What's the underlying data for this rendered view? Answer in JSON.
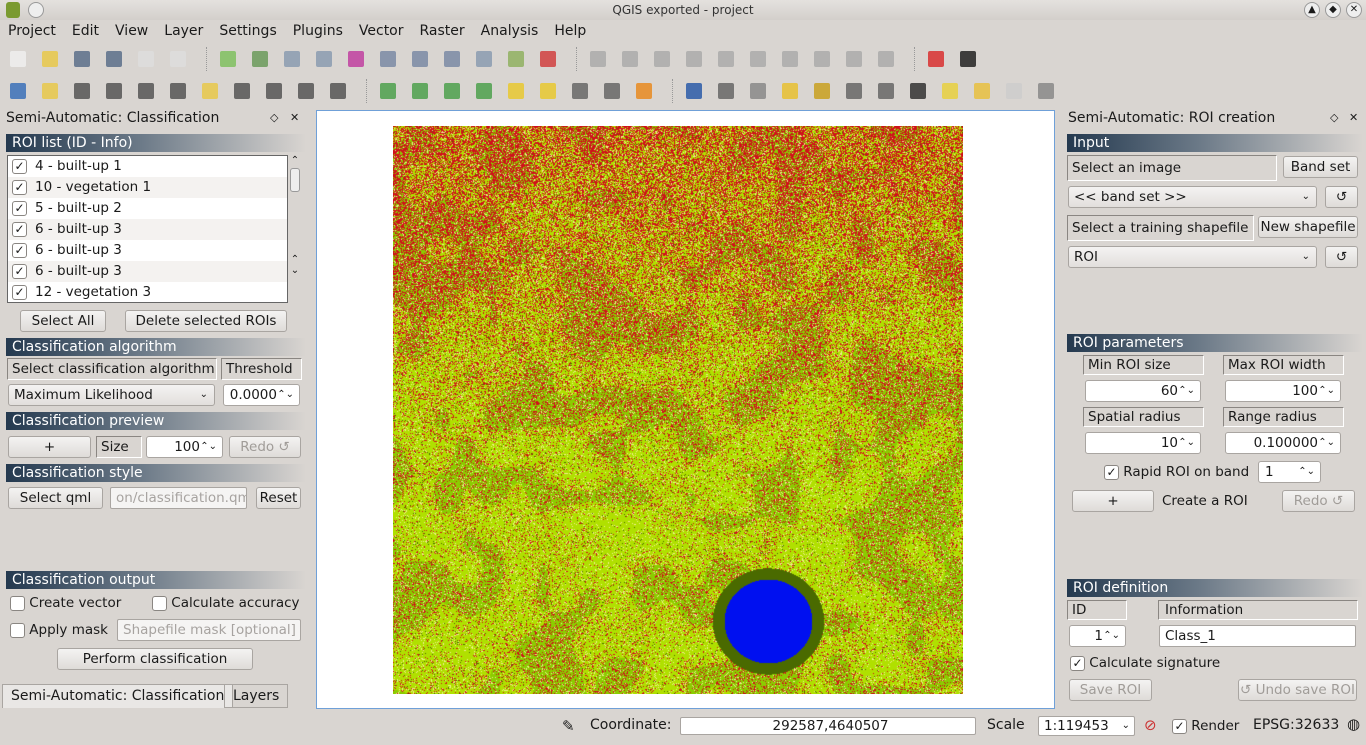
{
  "window": {
    "title": "QGIS exported - project",
    "controls": [
      "▲",
      "◆",
      "✕"
    ]
  },
  "menu": [
    "Project",
    "Edit",
    "View",
    "Layer",
    "Settings",
    "Plugins",
    "Vector",
    "Raster",
    "Analysis",
    "Help"
  ],
  "toolbar_icons": {
    "row1": [
      [
        "new-project-icon",
        "#eee"
      ],
      [
        "open-project-icon",
        "#e8c84a"
      ],
      [
        "save-project-icon",
        "#5a6f8a"
      ],
      [
        "save-as-icon",
        "#5a6f8a"
      ],
      [
        "new-print-composer-icon",
        "#ddd"
      ],
      [
        "composer-manager-icon",
        "#ddd"
      ],
      [
        "add-vector-layer-icon",
        "#7fbf5f"
      ],
      [
        "add-raster-layer-icon",
        "#6a9a5a"
      ],
      [
        "add-postgis-layer-icon",
        "#8a9bb0"
      ],
      [
        "add-spatialite-layer-icon",
        "#8a9bb0"
      ],
      [
        "add-mssql-layer-icon",
        "#c03fa0"
      ],
      [
        "add-wms-layer-icon",
        "#7a8aa5"
      ],
      [
        "add-wcs-layer-icon",
        "#7a8aa5"
      ],
      [
        "add-wfs-layer-icon",
        "#7a8aa5"
      ],
      [
        "add-delimited-text-icon",
        "#8a9bb0"
      ],
      [
        "new-shapefile-icon",
        "#8fb060"
      ],
      [
        "remove-layer-icon",
        "#d04040"
      ],
      [
        "digitize-icon",
        "#aaa"
      ],
      [
        "edit-pencil-icon",
        "#aaa"
      ],
      [
        "save-edits-icon",
        "#aaa"
      ],
      [
        "add-feature-icon",
        "#aaa"
      ],
      [
        "move-feature-icon",
        "#aaa"
      ],
      [
        "node-tool-icon",
        "#aaa"
      ],
      [
        "delete-selected-icon",
        "#aaa"
      ],
      [
        "cut-icon",
        "#aaa"
      ],
      [
        "copy-icon",
        "#aaa"
      ],
      [
        "paste-icon",
        "#aaa"
      ],
      [
        "help-icon",
        "#d83030"
      ],
      [
        "whats-this-icon",
        "#222"
      ]
    ],
    "row2": [
      [
        "pan-icon",
        "#3a70b8"
      ],
      [
        "pan-to-selection-icon",
        "#e8c84a"
      ],
      [
        "zoom-in-icon",
        "#555"
      ],
      [
        "zoom-out-icon",
        "#555"
      ],
      [
        "zoom-actual-icon",
        "#555"
      ],
      [
        "zoom-full-icon",
        "#555"
      ],
      [
        "zoom-selection-icon",
        "#e8c84a"
      ],
      [
        "zoom-layer-icon",
        "#555"
      ],
      [
        "zoom-last-icon",
        "#555"
      ],
      [
        "zoom-next-icon",
        "#555"
      ],
      [
        "zoom-native-icon",
        "#555"
      ],
      [
        "histogram-stretch-icon",
        "#4ca04c"
      ],
      [
        "histogram-local-icon",
        "#4ca04c"
      ],
      [
        "histogram-full-icon",
        "#4ca04c"
      ],
      [
        "histogram-cumulative-icon",
        "#4ca04c"
      ],
      [
        "brightness-up-icon",
        "#e8c830"
      ],
      [
        "brightness-down-icon",
        "#e8c830"
      ],
      [
        "contrast-up-icon",
        "#666"
      ],
      [
        "contrast-down-icon",
        "#666"
      ],
      [
        "scp-plugin-icon",
        "#e88a20"
      ],
      [
        "identify-icon",
        "#2a5aa8"
      ],
      [
        "run-action-icon",
        "#666"
      ],
      [
        "select-features-icon",
        "#888"
      ],
      [
        "deselect-icon",
        "#e8c030"
      ],
      [
        "expression-select-icon",
        "#c8a020"
      ],
      [
        "attribute-table-icon",
        "#666"
      ],
      [
        "field-calculator-icon",
        "#666"
      ],
      [
        "measure-icon",
        "#333"
      ],
      [
        "map-tips-icon",
        "#e8d040"
      ],
      [
        "new-bookmark-icon",
        "#e8c040"
      ],
      [
        "show-bookmarks-icon",
        "#ccc"
      ],
      [
        "text-annotation-icon",
        "#888"
      ]
    ]
  },
  "left_dock": {
    "title": "Semi-Automatic: Classification",
    "roi_section": "ROI list (ID - Info)",
    "roi_list": [
      "4 - built-up 1",
      "10 - vegetation 1",
      "5 - built-up 2",
      "6 - built-up 3",
      "6 - built-up 3",
      "6 - built-up 3",
      "12 - vegetation 3"
    ],
    "select_all": "Select All",
    "delete_selected": "Delete selected ROIs",
    "algorithm_section": "Classification algorithm",
    "select_algorithm_label": "Select classification algorithm",
    "threshold_label": "Threshold",
    "algorithm_value": "Maximum Likelihood",
    "threshold_value": "0.0000",
    "preview_section": "Classification preview",
    "preview_plus": "+",
    "size_label": "Size",
    "size_value": "100",
    "redo": "Redo ↺",
    "style_section": "Classification style",
    "select_qml": "Select qml",
    "qml_path": "on/classification.qml",
    "reset": "Reset",
    "output_section": "Classification output",
    "create_vector": "Create vector",
    "calculate_accuracy": "Calculate accuracy",
    "apply_mask": "Apply mask",
    "mask_placeholder": "Shapefile mask [optional]",
    "perform": "Perform classification",
    "tabs": [
      "Semi-Automatic: Classification",
      "Layers"
    ]
  },
  "right_dock": {
    "title": "Semi-Automatic: ROI creation",
    "input_section": "Input",
    "select_image": "Select an image",
    "band_set": "Band set",
    "image_value": "<< band set >>",
    "select_shapefile": "Select a training shapefile",
    "new_shapefile": "New shapefile",
    "shapefile_value": "ROI",
    "refresh": "↺",
    "params_section": "ROI parameters",
    "min_roi_size": "Min ROI size",
    "max_roi_width": "Max ROI width",
    "min_roi_value": "60",
    "max_roi_value": "100",
    "spatial_radius": "Spatial radius",
    "range_radius": "Range radius",
    "spatial_value": "10",
    "range_value": "0.100000",
    "rapid_roi": "Rapid ROI on band",
    "band_value": "1",
    "plus": "+",
    "create_roi": "Create a ROI",
    "redo": "Redo ↺",
    "definition_section": "ROI definition",
    "id_label": "ID",
    "info_label": "Information",
    "id_value": "1",
    "info_value": "Class_1",
    "calc_signature": "Calculate signature",
    "save_roi": "Save ROI",
    "undo_save": "↺ Undo save ROI"
  },
  "status": {
    "coordinate_label": "Coordinate:",
    "coordinate": "292587,4640507",
    "scale_label": "Scale",
    "scale": "1:119453",
    "render": "Render",
    "crs": "EPSG:32633"
  },
  "colors": {
    "built_up": "#d0101a",
    "vegetation": "#b0e000",
    "grass": "#8ccc00",
    "bare": "#f2ee90",
    "dark_veg": "#4a6a00",
    "water": "#0010f0",
    "section_header": "#24394f"
  }
}
